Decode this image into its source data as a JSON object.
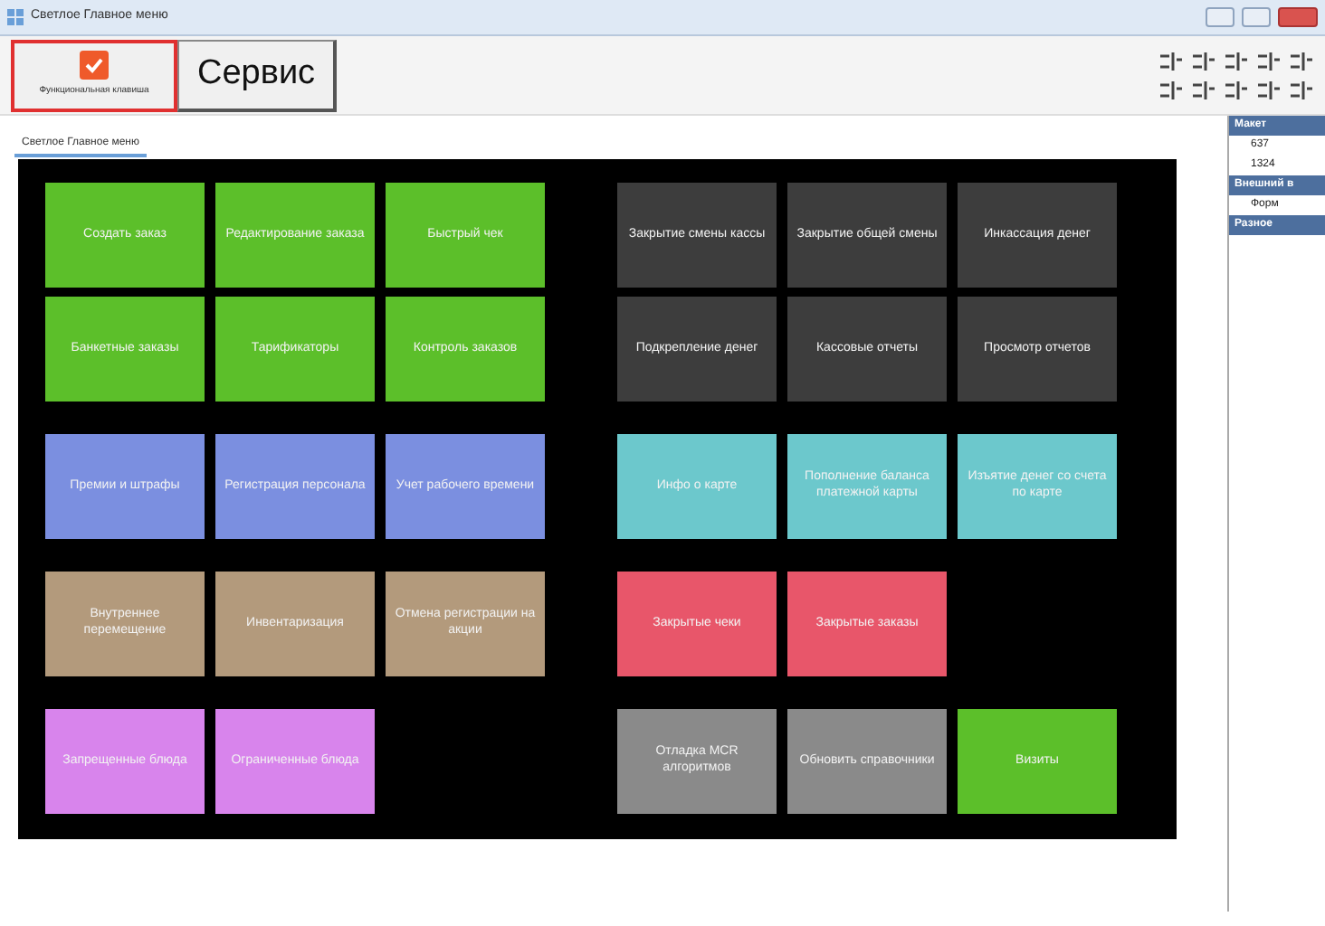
{
  "window": {
    "title": "Светлое Главное меню"
  },
  "toolbar": {
    "buttons": [
      {
        "kind": "icon",
        "label": "Функциональная клавиша",
        "selected": true
      },
      {
        "kind": "text",
        "label": "Сервис",
        "selected": false
      }
    ]
  },
  "tab": {
    "label": "Светлое Главное меню"
  },
  "tile_rows": [
    {
      "left": [
        {
          "label": "Создать заказ",
          "color": "#5cbf2a"
        },
        {
          "label": "Редактирование заказа",
          "color": "#5cbf2a"
        },
        {
          "label": "Быстрый чек",
          "color": "#5cbf2a"
        }
      ],
      "right": [
        {
          "label": "Закрытие смены кассы",
          "color": "#3d3d3d"
        },
        {
          "label": "Закрытие общей смены",
          "color": "#3d3d3d"
        },
        {
          "label": "Инкассация денег",
          "color": "#3d3d3d"
        }
      ]
    },
    {
      "left": [
        {
          "label": "Банкетные заказы",
          "color": "#5cbf2a"
        },
        {
          "label": "Тарификаторы",
          "color": "#5cbf2a"
        },
        {
          "label": "Контроль заказов",
          "color": "#5cbf2a"
        }
      ],
      "right": [
        {
          "label": "Подкрепление денег",
          "color": "#3d3d3d"
        },
        {
          "label": "Кассовые отчеты",
          "color": "#3d3d3d"
        },
        {
          "label": "Просмотр отчетов",
          "color": "#3d3d3d"
        }
      ]
    },
    {
      "left": [
        {
          "label": "Премии и штрафы",
          "color": "#7b8fe0"
        },
        {
          "label": "Регистрация персонала",
          "color": "#7b8fe0"
        },
        {
          "label": "Учет рабочего времени",
          "color": "#7b8fe0"
        }
      ],
      "right": [
        {
          "label": "Инфо о карте",
          "color": "#6cc8cc"
        },
        {
          "label": "Пополнение баланса платежной карты",
          "color": "#6cc8cc"
        },
        {
          "label": "Изъятие денег со счета по карте",
          "color": "#6cc8cc"
        }
      ]
    },
    {
      "left": [
        {
          "label": "Внутреннее перемещение",
          "color": "#b39a7c"
        },
        {
          "label": "Инвентаризация",
          "color": "#b39a7c"
        },
        {
          "label": "Отмена регистрации на акции",
          "color": "#b39a7c"
        }
      ],
      "right": [
        {
          "label": "Закрытые чеки",
          "color": "#e8566a"
        },
        {
          "label": "Закрытые заказы",
          "color": "#e8566a"
        }
      ]
    },
    {
      "left": [
        {
          "label": "Запрещенные блюда",
          "color": "#d884ec"
        },
        {
          "label": "Ограниченные блюда",
          "color": "#d884ec"
        }
      ],
      "right": [
        {
          "label": "Отладка MCR алгоритмов",
          "color": "#8a8a8a"
        },
        {
          "label": "Обновить справочники",
          "color": "#8a8a8a"
        },
        {
          "label": "Визиты",
          "color": "#5cbf2a"
        }
      ]
    }
  ],
  "properties": [
    {
      "category": "Макет",
      "items": [
        "637",
        "1324"
      ]
    },
    {
      "category": "Внешний в",
      "items": [
        "Форм"
      ]
    },
    {
      "category": "Разное"
    }
  ]
}
